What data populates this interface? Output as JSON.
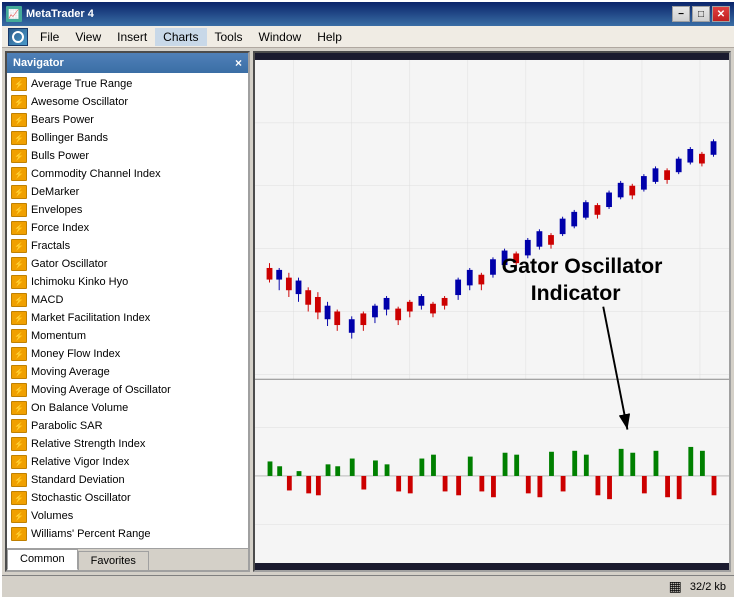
{
  "window": {
    "title": "MetaTrader 4",
    "min_btn": "−",
    "max_btn": "□",
    "close_btn": "✕"
  },
  "menu": {
    "items": [
      "File",
      "View",
      "Insert",
      "Charts",
      "Tools",
      "Window",
      "Help"
    ]
  },
  "navigator": {
    "header": "Navigator",
    "close_label": "×",
    "items": [
      "Average True Range",
      "Awesome Oscillator",
      "Bears Power",
      "Bollinger Bands",
      "Bulls Power",
      "Commodity Channel Index",
      "DeMarker",
      "Envelopes",
      "Force Index",
      "Fractals",
      "Gator Oscillator",
      "Ichimoku Kinko Hyo",
      "MACD",
      "Market Facilitation Index",
      "Momentum",
      "Money Flow Index",
      "Moving Average",
      "Moving Average of Oscillator",
      "On Balance Volume",
      "Parabolic SAR",
      "Relative Strength Index",
      "Relative Vigor Index",
      "Standard Deviation",
      "Stochastic Oscillator",
      "Volumes",
      "Williams' Percent Range"
    ],
    "tabs": [
      "Common",
      "Favorites"
    ]
  },
  "chart": {
    "annotation_line1": "Gator Oscillator",
    "annotation_line2": "Indicator"
  },
  "statusbar": {
    "text": "32/2 kb"
  }
}
